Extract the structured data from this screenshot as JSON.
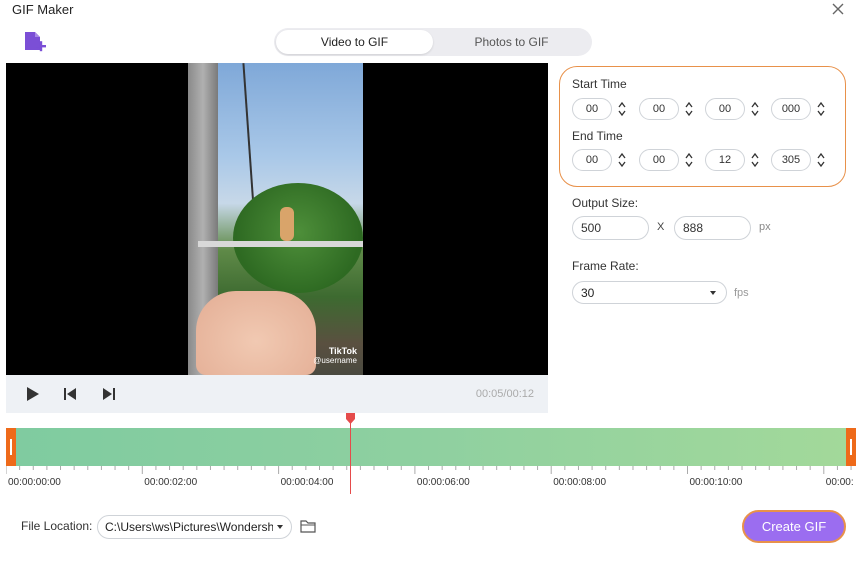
{
  "window": {
    "title": "GIF Maker"
  },
  "tabs": [
    {
      "label": "Video to GIF",
      "active": true
    },
    {
      "label": "Photos to GIF",
      "active": false
    }
  ],
  "video": {
    "watermark": "TikTok",
    "watermark_sub": "@username",
    "time_display": "00:05/00:12"
  },
  "start_time": {
    "label": "Start Time",
    "hh": "00",
    "mm": "00",
    "ss": "00",
    "ms": "000"
  },
  "end_time": {
    "label": "End Time",
    "hh": "00",
    "mm": "00",
    "ss": "12",
    "ms": "305"
  },
  "output_size": {
    "label": "Output Size:",
    "width": "500",
    "separator": "X",
    "height": "888",
    "unit": "px"
  },
  "frame_rate": {
    "label": "Frame Rate:",
    "value": "30",
    "unit": "fps"
  },
  "timeline": {
    "ticks": [
      "00:00:00:00",
      "00:00:02:00",
      "00:00:04:00",
      "00:00:06:00",
      "00:00:08:00",
      "00:00:10:00",
      "00:00:"
    ],
    "playhead_seconds": 4.2
  },
  "file_location": {
    "label": "File Location:",
    "value": "C:\\Users\\ws\\Pictures\\Wondershare"
  },
  "create_button": {
    "label": "Create GIF"
  },
  "colors": {
    "accent": "#9b6df0",
    "highlight": "#e8914a",
    "timeline": "#8fd0a0",
    "handle": "#ee6a1a"
  }
}
